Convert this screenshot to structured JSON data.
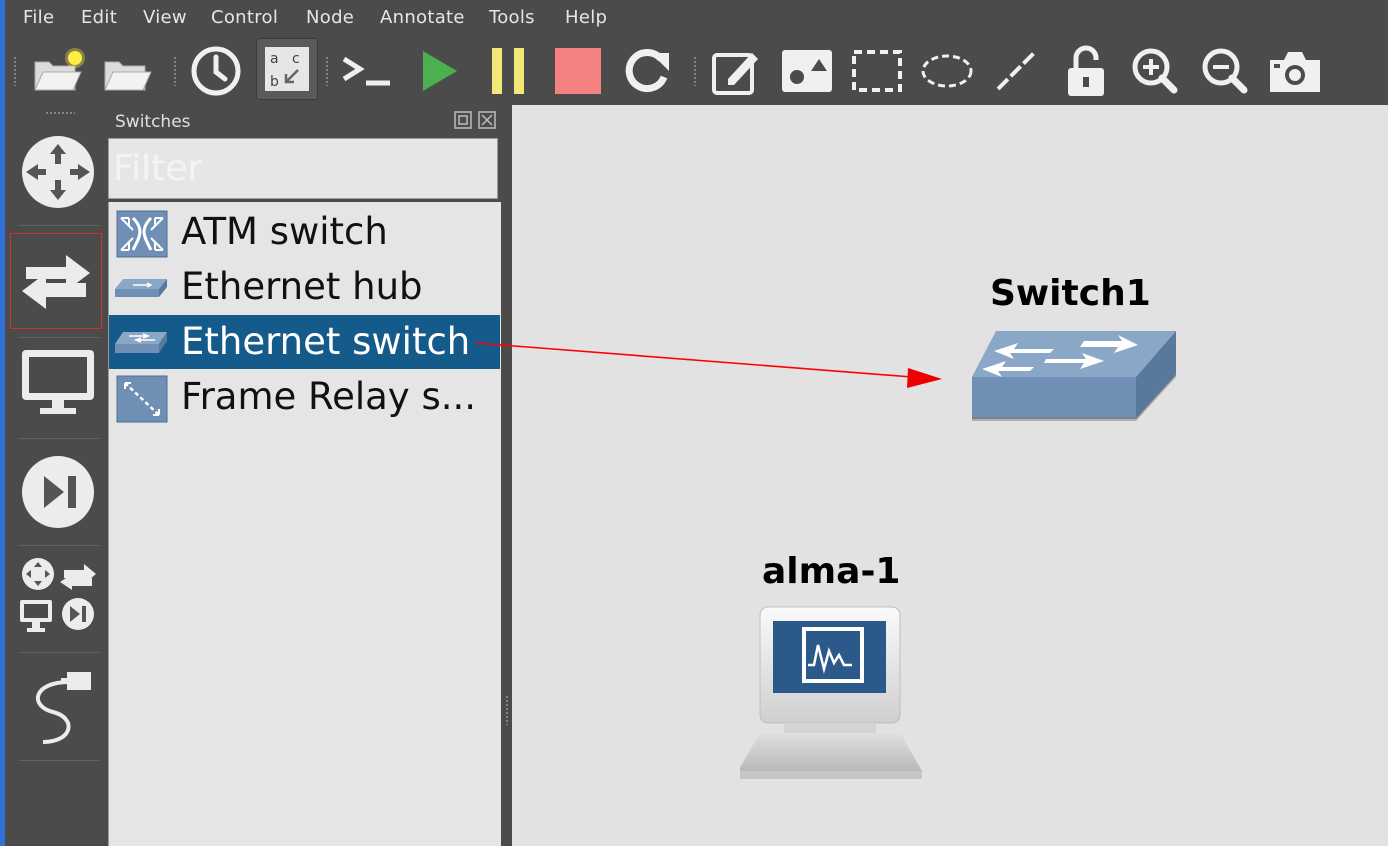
{
  "menu": [
    "File",
    "Edit",
    "View",
    "Control",
    "Node",
    "Annotate",
    "Tools",
    "Help"
  ],
  "toolbar": {
    "items": [
      "new-project-icon",
      "open-project-icon",
      "snapshot-icon",
      "show-interface-labels-icon",
      "console-icon",
      "start-icon",
      "suspend-icon",
      "stop-icon",
      "reload-icon",
      "add-note-icon",
      "insert-image-icon",
      "draw-rectangle-icon",
      "draw-ellipse-icon",
      "draw-line-icon",
      "lock-icon",
      "zoom-in-icon",
      "zoom-out-icon",
      "screenshot-icon"
    ]
  },
  "devices": {
    "items": [
      "routers-icon",
      "switches-icon",
      "end-devices-icon",
      "security-devices-icon",
      "all-devices-icon",
      "add-link-icon"
    ],
    "selected": "switches-icon"
  },
  "dock": {
    "title": "Switches",
    "filter_placeholder": "Filter",
    "items": [
      {
        "label": "ATM switch",
        "icon": "atm-switch-icon"
      },
      {
        "label": "Ethernet hub",
        "icon": "ethernet-hub-icon"
      },
      {
        "label": "Ethernet switch",
        "icon": "ethernet-switch-icon"
      },
      {
        "label": "Frame Relay s...",
        "icon": "frame-relay-switch-icon"
      }
    ],
    "selected_index": 2
  },
  "canvas": {
    "nodes": [
      {
        "label": "Switch1",
        "type": "ethernet-switch"
      },
      {
        "label": "alma-1",
        "type": "vpcs-host"
      }
    ]
  },
  "colors": {
    "selection": "#145a8a",
    "highlight_frame": "#d03030",
    "drag_arrow": "#ff0000",
    "start_green": "#4caf50",
    "suspend_yellow": "#f3e77a",
    "stop_red": "#f58080",
    "switch_blue": "#7a97b6"
  }
}
